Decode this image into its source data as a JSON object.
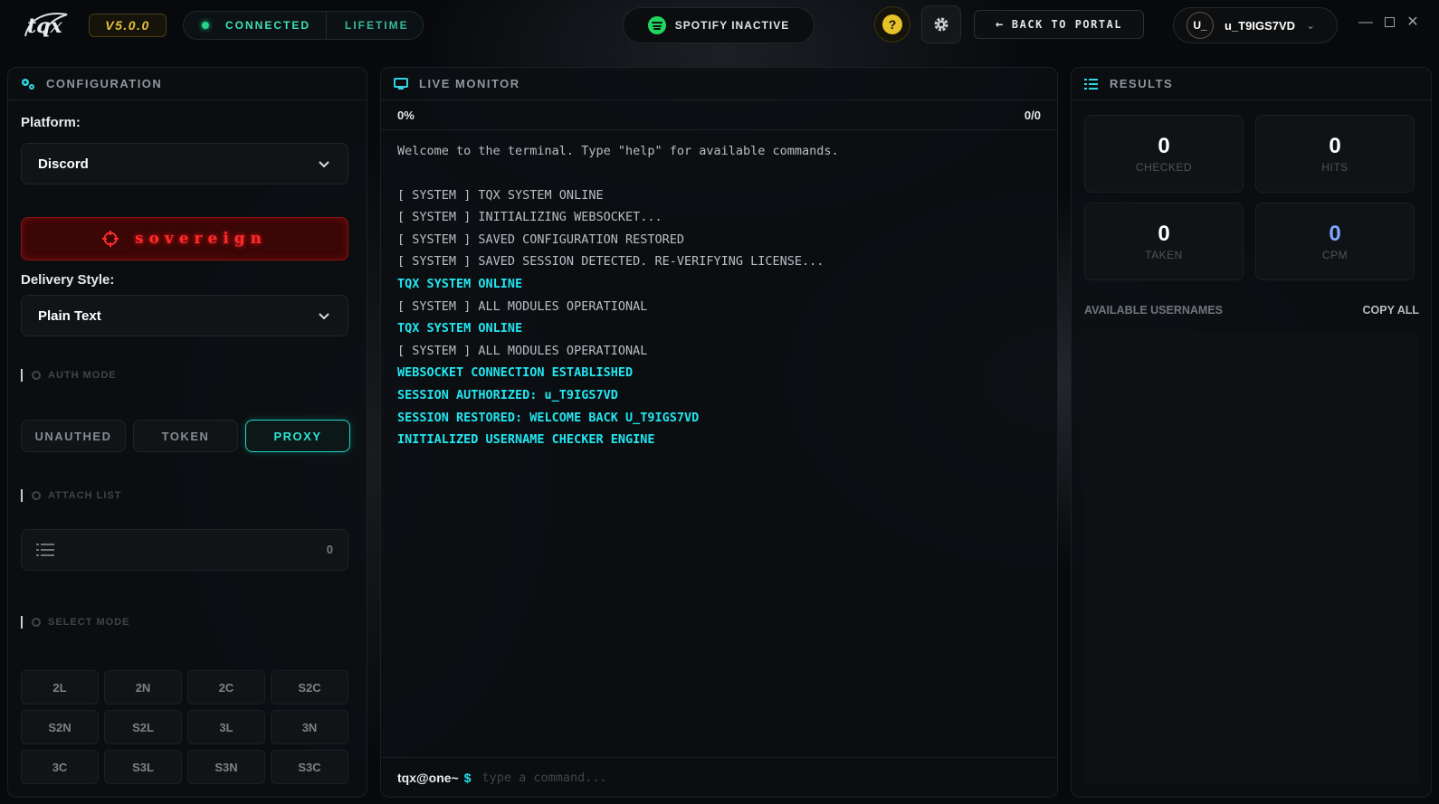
{
  "topbar": {
    "logo_text": "tqx",
    "version": "V5.0.0",
    "status": "CONNECTED",
    "license": "LIFETIME",
    "spotify": "SPOTIFY INACTIVE",
    "help": "?",
    "back": "BACK TO PORTAL",
    "avatar": "U_",
    "username": "u_T9IGS7VD"
  },
  "config": {
    "header": "CONFIGURATION",
    "platform_label": "Platform:",
    "platform_value": "Discord",
    "theme_button": "sovereign",
    "delivery_label": "Delivery Style:",
    "delivery_value": "Plain Text",
    "auth_mode_label": "AUTH MODE",
    "auth_options": [
      "UNAUTHED",
      "TOKEN",
      "PROXY"
    ],
    "auth_selected": "PROXY",
    "attach_label": "ATTACH LIST",
    "attach_count": "0",
    "select_mode_label": "SELECT MODE",
    "modes": [
      "2L",
      "2N",
      "2C",
      "S2C",
      "S2N",
      "S2L",
      "3L",
      "3N",
      "3C",
      "S3L",
      "S3N",
      "S3C"
    ]
  },
  "monitor": {
    "header": "LIVE MONITOR",
    "progress": "0%",
    "counter": "0/0",
    "lines": [
      {
        "text": "Welcome to the terminal. Type \"help\" for available commands.",
        "style": "gray"
      },
      {
        "text": "",
        "style": "blank"
      },
      {
        "text": "[ SYSTEM ] TQX SYSTEM ONLINE",
        "style": "gray"
      },
      {
        "text": "[ SYSTEM ] INITIALIZING WEBSOCKET...",
        "style": "gray"
      },
      {
        "text": "[ SYSTEM ] SAVED CONFIGURATION RESTORED",
        "style": "gray"
      },
      {
        "text": "[ SYSTEM ] SAVED SESSION DETECTED. RE-VERIFYING LICENSE...",
        "style": "gray"
      },
      {
        "text": "TQX SYSTEM ONLINE",
        "style": "cyan"
      },
      {
        "text": "[ SYSTEM ] ALL MODULES OPERATIONAL",
        "style": "gray"
      },
      {
        "text": "TQX SYSTEM ONLINE",
        "style": "cyan"
      },
      {
        "text": "[ SYSTEM ] ALL MODULES OPERATIONAL",
        "style": "gray"
      },
      {
        "text": "WEBSOCKET CONNECTION ESTABLISHED",
        "style": "cyan"
      },
      {
        "text": "SESSION AUTHORIZED: u_T9IGS7VD",
        "style": "cyan"
      },
      {
        "text": "SESSION RESTORED: WELCOME BACK U_T9IGS7VD",
        "style": "cyan"
      },
      {
        "text": "INITIALIZED USERNAME CHECKER ENGINE",
        "style": "cyan"
      }
    ],
    "prompt": "tqx@one~",
    "prompt_symbol": "$",
    "input_placeholder": "type a command...",
    "input_value": ""
  },
  "results": {
    "header": "RESULTS",
    "stats": [
      {
        "value": "0",
        "label": "CHECKED"
      },
      {
        "value": "0",
        "label": "HITS"
      },
      {
        "value": "0",
        "label": "TAKEN"
      },
      {
        "value": "0",
        "label": "CPM"
      }
    ],
    "available_label": "AVAILABLE USERNAMES",
    "copy_all": "COPY ALL"
  },
  "colors": {
    "accent_cyan": "#22e6f0",
    "status_green": "#23d48c",
    "sovereign_red": "#ff2a2a",
    "version_gold": "#e5c13a",
    "cpm_blue": "#7ea8ff"
  }
}
